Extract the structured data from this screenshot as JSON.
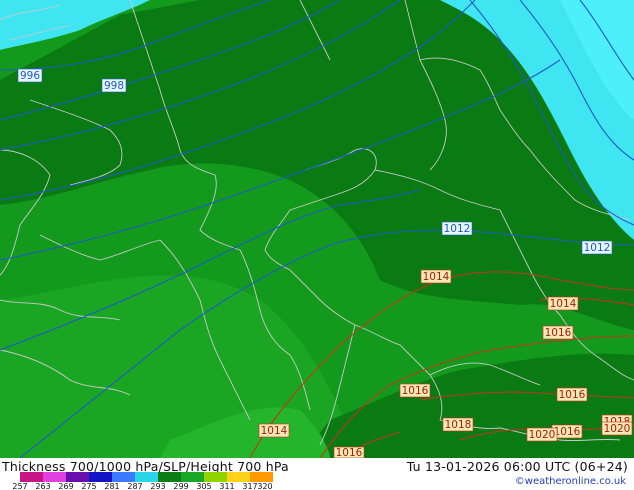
{
  "title": "Thickness 700/1000 hPa/SLP/Height 700 hPa",
  "valid_time": "Tu 13-01-2026 06:00 UTC (06+24)",
  "credit": "©weatheronline.co.uk",
  "colors": {
    "cyan_sea": "#3fe6f2",
    "dark_green": "#0a7a13",
    "mid_green": "#139a1c",
    "light_green": "#1fad28",
    "isobar_blue": "#1e5bc6",
    "isobar_red": "#c8331a",
    "label_fill_blue": "#e8f7ff",
    "label_fill_red": "#f7e7b5"
  },
  "legend": {
    "ticks": [
      "257",
      "263",
      "269",
      "275",
      "281",
      "287",
      "293",
      "299",
      "305",
      "311",
      "317",
      "320"
    ],
    "swatches": [
      "#c71585",
      "#e040e0",
      "#6a0dad",
      "#1515c8",
      "#3a7bff",
      "#29d6e8",
      "#0b7f16",
      "#19a826",
      "#8fd400",
      "#ffd21a",
      "#ff9b00"
    ]
  },
  "isobar_labels": [
    {
      "id": "996",
      "text": "996",
      "kind": "blue"
    },
    {
      "id": "998",
      "text": "998",
      "kind": "blue"
    },
    {
      "id": "1012a",
      "text": "1012",
      "kind": "blue"
    },
    {
      "id": "1012b",
      "text": "1012",
      "kind": "blue"
    },
    {
      "id": "1014a",
      "text": "1014",
      "kind": "red"
    },
    {
      "id": "1014b",
      "text": "1014",
      "kind": "red"
    },
    {
      "id": "1014c",
      "text": "1014",
      "kind": "red"
    },
    {
      "id": "1016a",
      "text": "1016",
      "kind": "red"
    },
    {
      "id": "1016b",
      "text": "1016",
      "kind": "red"
    },
    {
      "id": "1016c",
      "text": "1016",
      "kind": "red"
    },
    {
      "id": "1016d",
      "text": "1016",
      "kind": "red"
    },
    {
      "id": "1016e",
      "text": "1016",
      "kind": "red"
    },
    {
      "id": "1018a",
      "text": "1018",
      "kind": "red"
    },
    {
      "id": "1018b",
      "text": "1018",
      "kind": "red"
    },
    {
      "id": "1020a",
      "text": "1020",
      "kind": "red"
    },
    {
      "id": "1020b",
      "text": "1020",
      "kind": "red"
    }
  ]
}
